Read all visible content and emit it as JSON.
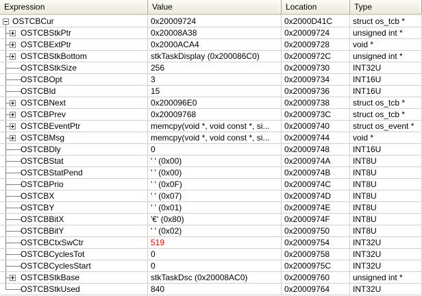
{
  "headers": {
    "expression": "Expression",
    "value": "Value",
    "location": "Location",
    "type": "Type"
  },
  "rows": [
    {
      "expr": "OSTCBCur",
      "value": "0x20009724",
      "location": "0x2000D41C",
      "type": "struct os_tcb *",
      "level": 0,
      "toggle": "minus"
    },
    {
      "expr": "OSTCBStkPtr",
      "value": "0x20008A38",
      "location": "0x20009724",
      "type": "unsigned int *",
      "level": 1,
      "toggle": "plus"
    },
    {
      "expr": "OSTCBExtPtr",
      "value": "0x2000ACA4",
      "location": "0x20009728",
      "type": "void *",
      "level": 1,
      "toggle": "plus"
    },
    {
      "expr": "OSTCBStkBottom",
      "value": "stkTaskDisplay (0x200086C0)",
      "location": "0x2000972C",
      "type": "unsigned int *",
      "level": 1,
      "toggle": "plus"
    },
    {
      "expr": "OSTCBStkSize",
      "value": "256",
      "location": "0x20009730",
      "type": "INT32U",
      "level": 1,
      "toggle": "none"
    },
    {
      "expr": "OSTCBOpt",
      "value": "3",
      "location": "0x20009734",
      "type": "INT16U",
      "level": 1,
      "toggle": "none"
    },
    {
      "expr": "OSTCBId",
      "value": "15",
      "location": "0x20009736",
      "type": "INT16U",
      "level": 1,
      "toggle": "none"
    },
    {
      "expr": "OSTCBNext",
      "value": "0x200096E0",
      "location": "0x20009738",
      "type": "struct os_tcb *",
      "level": 1,
      "toggle": "plus"
    },
    {
      "expr": "OSTCBPrev",
      "value": "0x20009768",
      "location": "0x2000973C",
      "type": "struct os_tcb *",
      "level": 1,
      "toggle": "plus"
    },
    {
      "expr": "OSTCBEventPtr",
      "value": "memcpy(void *, void const *, si...",
      "location": "0x20009740",
      "type": "struct os_event *",
      "level": 1,
      "toggle": "plus"
    },
    {
      "expr": "OSTCBMsg",
      "value": "memcpy(void *, void const *, si...",
      "location": "0x20009744",
      "type": "void *",
      "level": 1,
      "toggle": "plus"
    },
    {
      "expr": "OSTCBDly",
      "value": "0",
      "location": "0x20009748",
      "type": "INT16U",
      "level": 1,
      "toggle": "none"
    },
    {
      "expr": "OSTCBStat",
      "value": "' ' (0x00)",
      "location": "0x2000974A",
      "type": "INT8U",
      "level": 1,
      "toggle": "none"
    },
    {
      "expr": "OSTCBStatPend",
      "value": "' ' (0x00)",
      "location": "0x2000974B",
      "type": "INT8U",
      "level": 1,
      "toggle": "none"
    },
    {
      "expr": "OSTCBPrio",
      "value": "' ' (0x0F)",
      "location": "0x2000974C",
      "type": "INT8U",
      "level": 1,
      "toggle": "none"
    },
    {
      "expr": "OSTCBX",
      "value": "' ' (0x07)",
      "location": "0x2000974D",
      "type": "INT8U",
      "level": 1,
      "toggle": "none"
    },
    {
      "expr": "OSTCBY",
      "value": "' ' (0x01)",
      "location": "0x2000974E",
      "type": "INT8U",
      "level": 1,
      "toggle": "none"
    },
    {
      "expr": "OSTCBBitX",
      "value": "'€' (0x80)",
      "location": "0x2000974F",
      "type": "INT8U",
      "level": 1,
      "toggle": "none"
    },
    {
      "expr": "OSTCBBitY",
      "value": "' ' (0x02)",
      "location": "0x20009750",
      "type": "INT8U",
      "level": 1,
      "toggle": "none"
    },
    {
      "expr": "OSTCBCtxSwCtr",
      "value": "519",
      "location": "0x20009754",
      "type": "INT32U",
      "level": 1,
      "toggle": "none",
      "changed": true
    },
    {
      "expr": "OSTCBCyclesTot",
      "value": "0",
      "location": "0x20009758",
      "type": "INT32U",
      "level": 1,
      "toggle": "none"
    },
    {
      "expr": "OSTCBCyclesStart",
      "value": "0",
      "location": "0x2000975C",
      "type": "INT32U",
      "level": 1,
      "toggle": "none"
    },
    {
      "expr": "OSTCBStkBase",
      "value": "stkTaskDsc (0x20008AC0)",
      "location": "0x20009760",
      "type": "unsigned int *",
      "level": 1,
      "toggle": "plus"
    },
    {
      "expr": "OSTCBStkUsed",
      "value": "840",
      "location": "0x20009764",
      "type": "INT32U",
      "level": 1,
      "toggle": "none",
      "last": true
    }
  ],
  "colors": {
    "changed_value": "#e00000",
    "header_bg": "#ece9d8",
    "grid": "#d4d0c8",
    "tree_line": "#808080"
  },
  "icons": {
    "expand": "plus-box-icon",
    "collapse": "minus-box-icon"
  }
}
